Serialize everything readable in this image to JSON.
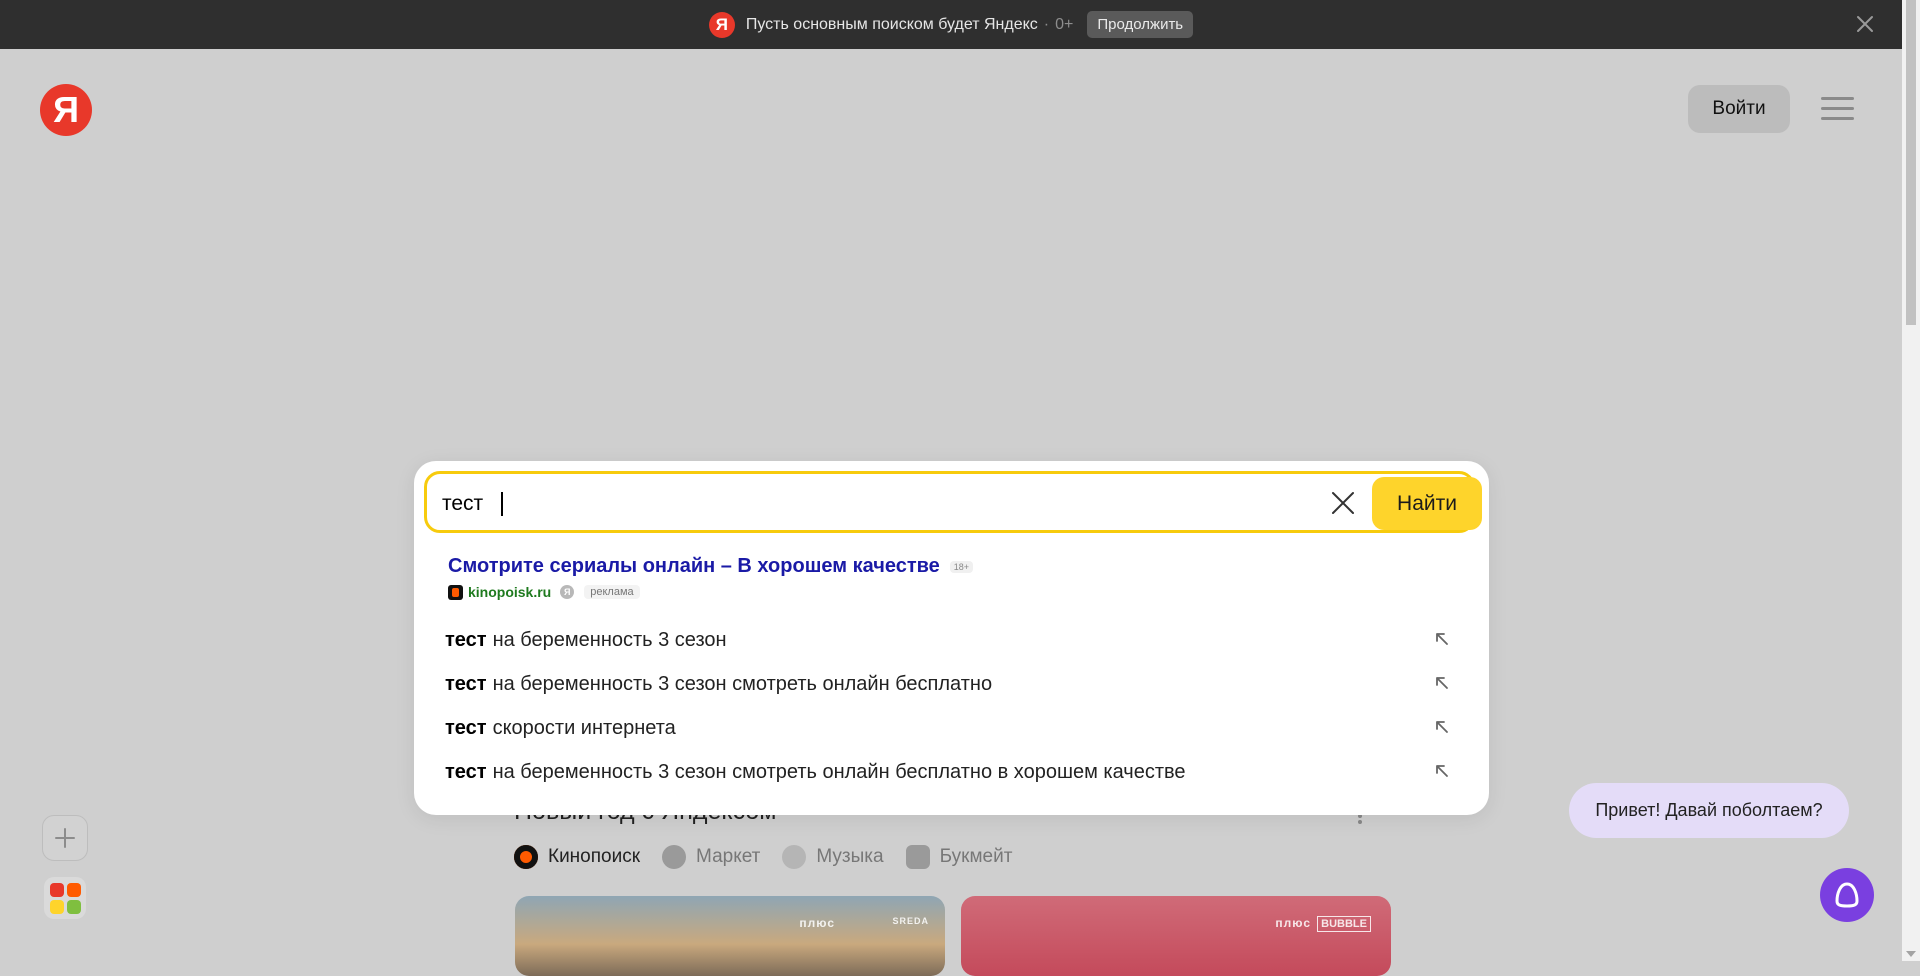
{
  "banner": {
    "logo_letter": "Я",
    "text": "Пусть основным поиском будет Яндекс",
    "age": "0+",
    "continue_label": "Продолжить"
  },
  "header": {
    "logo_letter": "Я",
    "login_label": "Войти"
  },
  "search": {
    "query": "тест",
    "find_label": "Найти",
    "ad": {
      "title": "Смотрите сериалы онлайн – В хорошем качестве",
      "age": "18+",
      "domain": "kinopoisk.ru",
      "ya_letter": "Я",
      "label": "реклама"
    },
    "suggestions": [
      {
        "bold": "тест",
        "rest": "на беременность 3 сезон"
      },
      {
        "bold": "тест",
        "rest": "на беременность 3 сезон смотреть онлайн бесплатно"
      },
      {
        "bold": "тест",
        "rest": "скорости интернета"
      },
      {
        "bold": "тест",
        "rest": "на беременность 3 сезон смотреть онлайн бесплатно в хорошем качестве"
      }
    ]
  },
  "feed": {
    "title": "Новый год с Яндексом",
    "services": [
      {
        "label": "Кинопоиск",
        "icon": "kinopoisk-icon",
        "color": "#ff5a00"
      },
      {
        "label": "Маркет",
        "icon": "market-icon",
        "color": "#8a8a8a"
      },
      {
        "label": "Музыка",
        "icon": "music-icon",
        "color": "#8a8a8a"
      },
      {
        "label": "Букмейт",
        "icon": "bookmate-icon",
        "color": "#8a8a8a"
      }
    ],
    "card_tags": [
      "плюс",
      "SREDA",
      "плюс",
      "BUBBLE"
    ]
  },
  "alice": {
    "greeting": "Привет! Давай поболтаем?"
  },
  "colors": {
    "brand_red": "#e8382a",
    "search_yellow": "#fed42b",
    "alice_purple": "#7a3fe0"
  }
}
